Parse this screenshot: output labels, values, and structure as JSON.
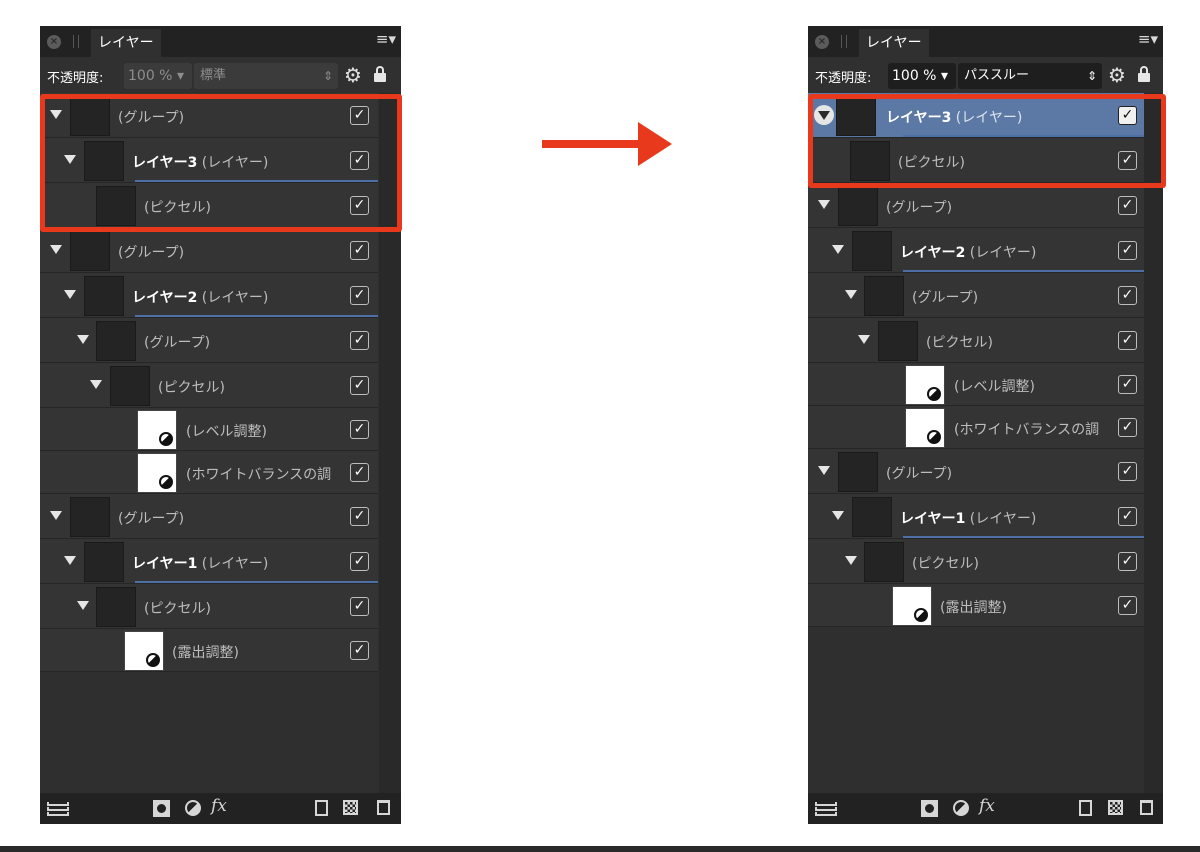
{
  "panels": [
    {
      "id": "before",
      "tab_label": "レイヤー",
      "opacity_label": "不透明度:",
      "opacity_value": "100 %",
      "blend_mode": "標準",
      "rows": [
        {
          "type": "group-root",
          "name": "",
          "kind": "(グループ)",
          "checked": true
        },
        {
          "type": "layer",
          "name": "レイヤー3",
          "kind": "(レイヤー)",
          "checked": true
        },
        {
          "type": "pixel",
          "name": "",
          "kind": "(ピクセル)",
          "checked": true
        },
        {
          "type": "group-root",
          "name": "",
          "kind": "(グループ)",
          "checked": true
        },
        {
          "type": "layer",
          "name": "レイヤー2",
          "kind": "(レイヤー)",
          "checked": true
        },
        {
          "type": "group",
          "name": "",
          "kind": "(グループ)",
          "checked": true
        },
        {
          "type": "pixel",
          "name": "",
          "kind": "(ピクセル)",
          "checked": true
        },
        {
          "type": "adjust",
          "name": "",
          "kind": "(レベル調整)",
          "checked": true
        },
        {
          "type": "adjust",
          "name": "",
          "kind": "(ホワイトバランスの調",
          "checked": true
        },
        {
          "type": "group-root",
          "name": "",
          "kind": "(グループ)",
          "checked": true
        },
        {
          "type": "layer",
          "name": "レイヤー1",
          "kind": "(レイヤー)",
          "checked": true
        },
        {
          "type": "pixel",
          "name": "",
          "kind": "(ピクセル)",
          "checked": true
        },
        {
          "type": "adjust",
          "name": "",
          "kind": "(露出調整)",
          "checked": true
        }
      ]
    },
    {
      "id": "after",
      "tab_label": "レイヤー",
      "opacity_label": "不透明度:",
      "opacity_value": "100 %",
      "blend_mode": "パススルー",
      "rows": [
        {
          "type": "layer-root",
          "name": "レイヤー3",
          "kind": "(レイヤー)",
          "checked": true,
          "selected": true
        },
        {
          "type": "pixel",
          "name": "",
          "kind": "(ピクセル)",
          "checked": true
        },
        {
          "type": "group-root",
          "name": "",
          "kind": "(グループ)",
          "checked": true
        },
        {
          "type": "layer",
          "name": "レイヤー2",
          "kind": "(レイヤー)",
          "checked": true
        },
        {
          "type": "group",
          "name": "",
          "kind": "(グループ)",
          "checked": true
        },
        {
          "type": "pixel",
          "name": "",
          "kind": "(ピクセル)",
          "checked": true
        },
        {
          "type": "adjust",
          "name": "",
          "kind": "(レベル調整)",
          "checked": true
        },
        {
          "type": "adjust",
          "name": "",
          "kind": "(ホワイトバランスの調",
          "checked": true
        },
        {
          "type": "group-root",
          "name": "",
          "kind": "(グループ)",
          "checked": true
        },
        {
          "type": "layer",
          "name": "レイヤー1",
          "kind": "(レイヤー)",
          "checked": true
        },
        {
          "type": "pixel",
          "name": "",
          "kind": "(ピクセル)",
          "checked": true
        },
        {
          "type": "adjust",
          "name": "",
          "kind": "(露出調整)",
          "checked": true
        }
      ]
    }
  ],
  "footer_icons": [
    "layers-icon",
    "mask-icon",
    "adjustment-icon",
    "fx-icon",
    "new-document-icon",
    "checkerboard-icon",
    "trash-icon"
  ],
  "icons": {
    "close": "close-icon",
    "menu": "menu-icon",
    "gear": "gear-icon",
    "lock": "lock-icon",
    "check": "✓"
  },
  "colors": {
    "panel_bg": "#2f2f2f",
    "selection": "#5b79a4",
    "highlight_border": "#e8391d",
    "arrow": "#e8391d"
  }
}
